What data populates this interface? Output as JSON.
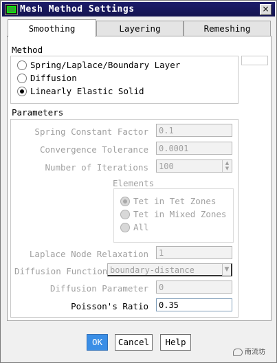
{
  "window": {
    "title": "Mesh Method Settings",
    "close_glyph": "×"
  },
  "tabs": [
    {
      "label": "Smoothing",
      "active": true
    },
    {
      "label": "Layering",
      "active": false
    },
    {
      "label": "Remeshing",
      "active": false
    }
  ],
  "method": {
    "label": "Method",
    "options": [
      {
        "label": "Spring/Laplace/Boundary Layer",
        "checked": false
      },
      {
        "label": "Diffusion",
        "checked": false
      },
      {
        "label": "Linearly Elastic Solid",
        "checked": true
      }
    ]
  },
  "parameters": {
    "label": "Parameters",
    "spring_constant_factor": {
      "label": "Spring Constant Factor",
      "value": "0.1"
    },
    "convergence_tolerance": {
      "label": "Convergence Tolerance",
      "value": "0.0001"
    },
    "number_of_iterations": {
      "label": "Number of Iterations",
      "value": "100"
    },
    "elements": {
      "label": "Elements",
      "options": [
        {
          "label": "Tet in Tet Zones",
          "checked": true
        },
        {
          "label": "Tet in Mixed Zones",
          "checked": false
        },
        {
          "label": "All",
          "checked": false
        }
      ]
    },
    "laplace_node_relaxation": {
      "label": "Laplace Node Relaxation",
      "value": "1"
    },
    "diffusion_function": {
      "label": "Diffusion Function",
      "value": "boundary-distance"
    },
    "diffusion_parameter": {
      "label": "Diffusion Parameter",
      "value": "0"
    },
    "poissons_ratio": {
      "label": "Poisson's Ratio",
      "value": "0.35"
    }
  },
  "buttons": {
    "ok": "OK",
    "cancel": "Cancel",
    "help": "Help"
  },
  "watermark": {
    "text": "南流坊"
  },
  "icons": {
    "close": "close-icon",
    "app": "app-icon",
    "spin_up": "▲",
    "spin_down": "▼",
    "dropdown": "▼"
  },
  "colors": {
    "title_bg": "#141450",
    "ok_button": "#3a8ee6"
  }
}
